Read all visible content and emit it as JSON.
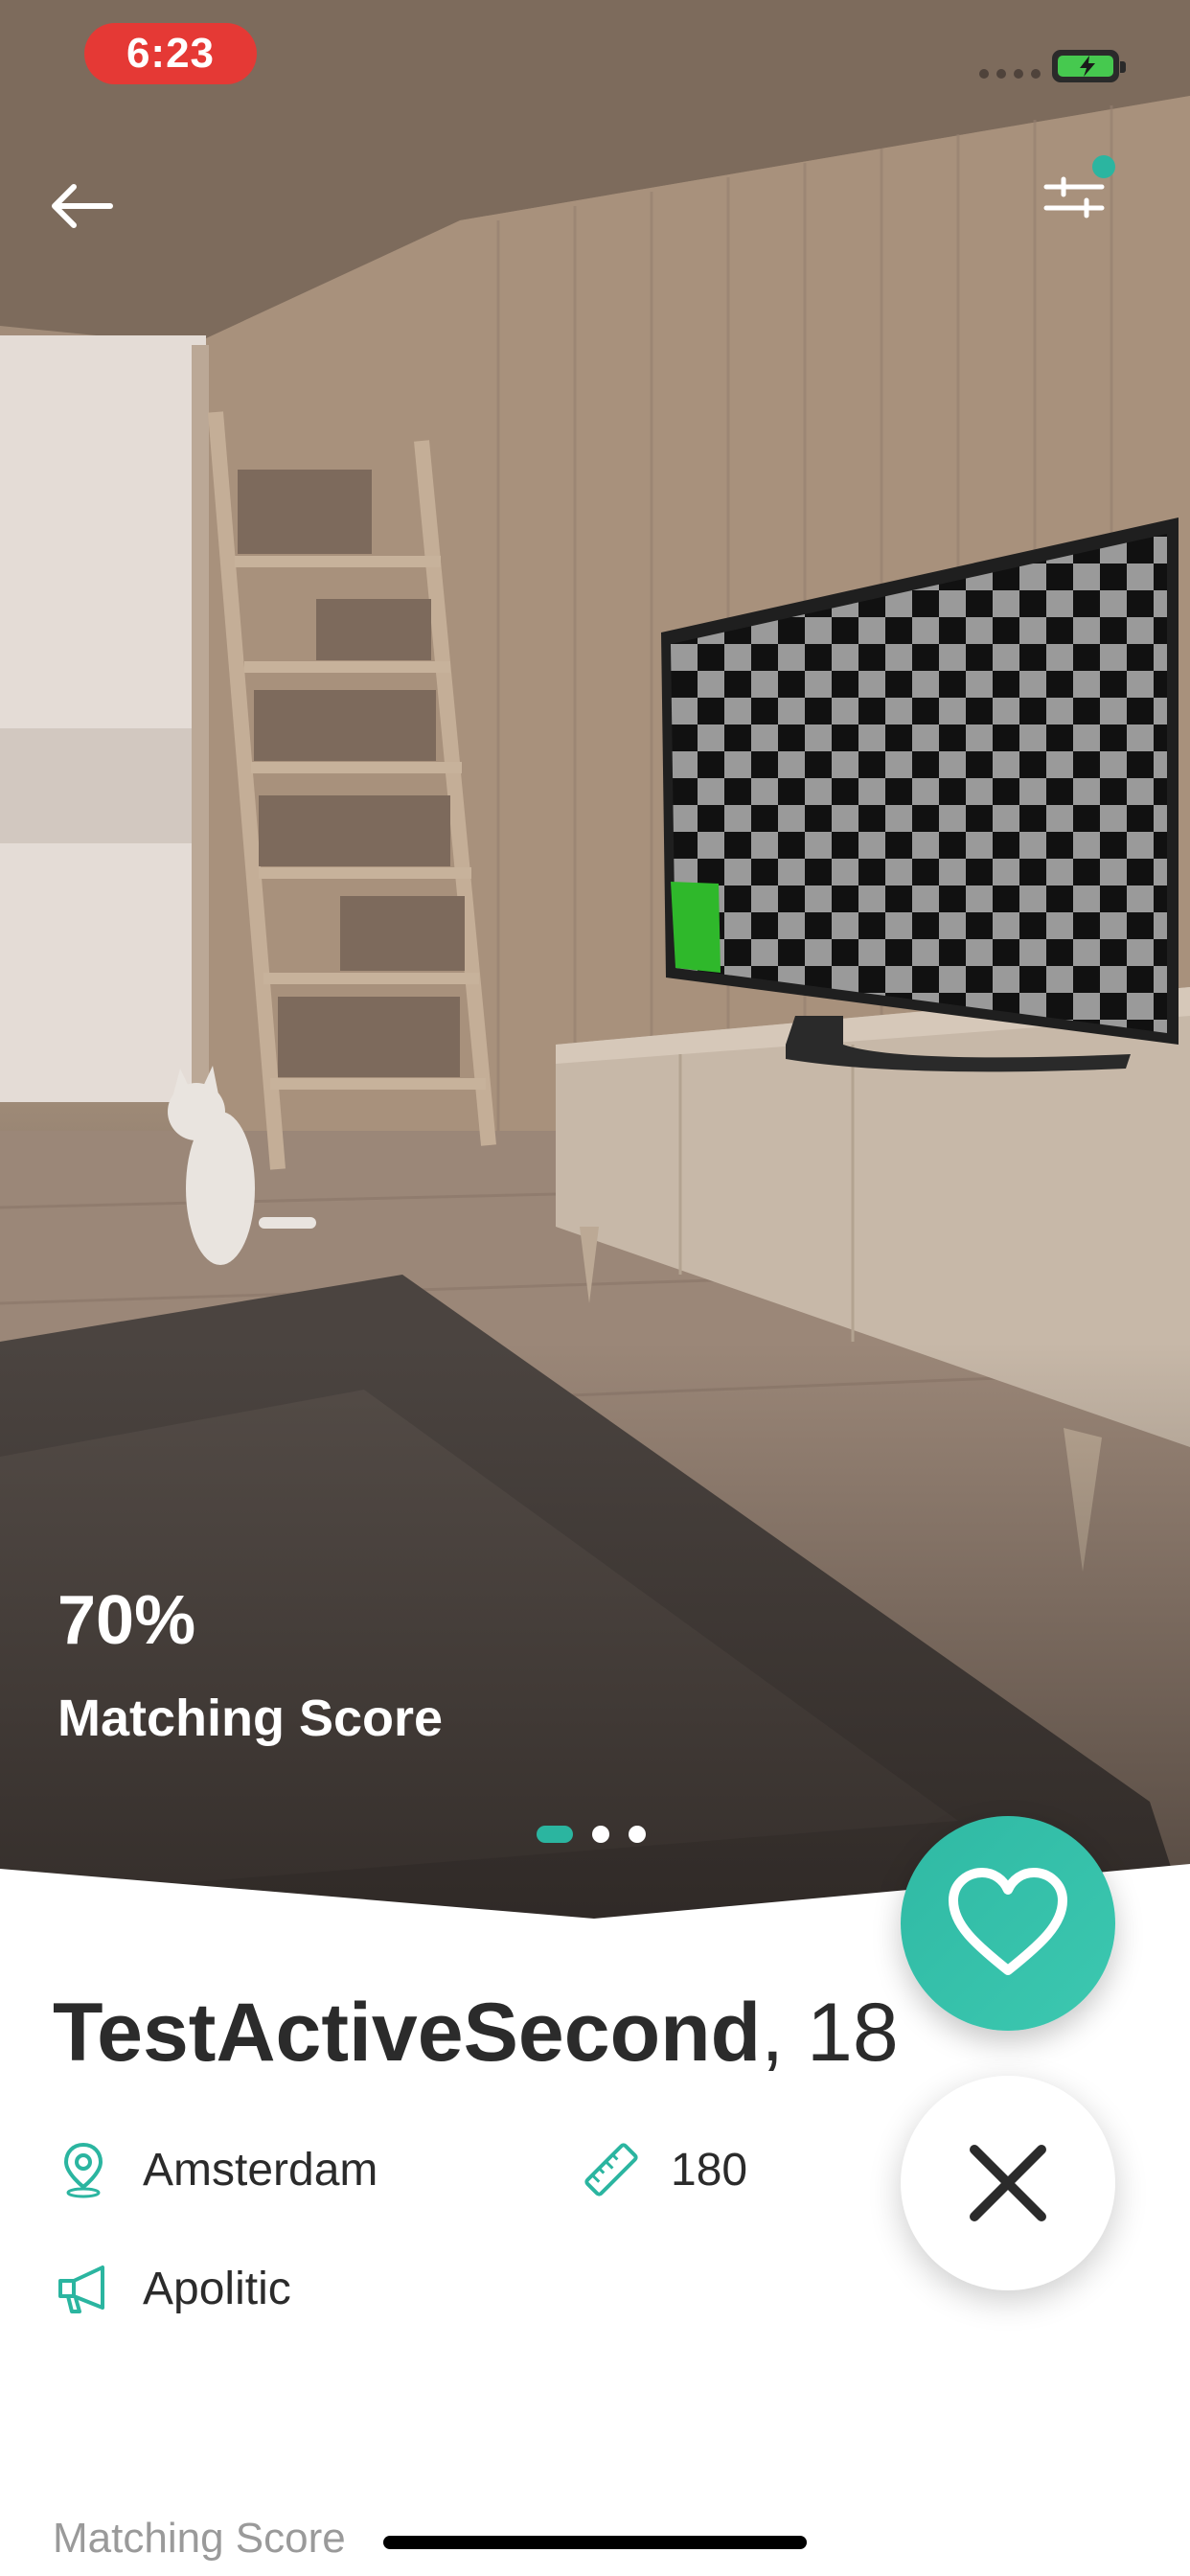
{
  "status_bar": {
    "time": "6:23",
    "battery_state": "charging",
    "colors": {
      "time_pill": "#e53935",
      "battery_fill": "#46c94f"
    }
  },
  "nav": {
    "back_icon": "arrow-left-icon",
    "filter_icon": "sliders-icon",
    "filter_badge_color": "#2bb5a0"
  },
  "photo": {
    "carousel_pages": 3,
    "active_page": 1
  },
  "match": {
    "score": "70%",
    "label": "Matching Score"
  },
  "profile": {
    "name": "TestActiveSecond",
    "age_suffix": ", 18",
    "city": "Amsterdam",
    "height": "180",
    "politics": "Apolitic"
  },
  "actions": {
    "like_icon": "heart-icon",
    "dismiss_icon": "close-icon"
  },
  "section": {
    "title": "Matching Score"
  },
  "theme": {
    "accent": "#2bb5a0",
    "text": "#2b2b2b",
    "muted": "#9a9a9a"
  }
}
